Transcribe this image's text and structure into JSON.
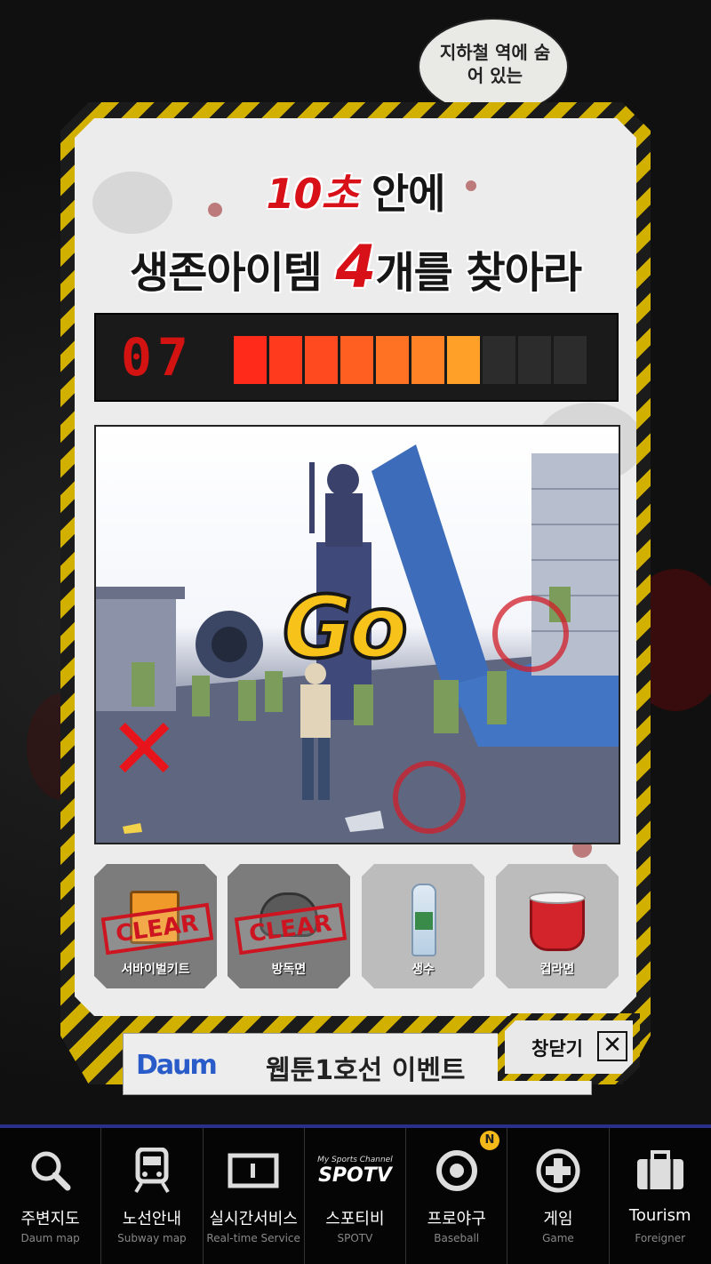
{
  "background": {
    "speech_bubble": "지하철 역에 숨어 있는"
  },
  "popup": {
    "title_line1": {
      "highlight": "10초",
      "rest": " 안에"
    },
    "title_line2": {
      "before": "생존아이템 ",
      "number": "4",
      "after": "개를 찾아라"
    },
    "timer": {
      "value": "07",
      "filled_segments": 7,
      "total_segments": 10,
      "segment_colors": [
        "#ff2a1a",
        "#ff3a1d",
        "#ff4a20",
        "#ff6022",
        "#ff7224",
        "#ff8226",
        "#ffa028"
      ]
    },
    "game_scene": {
      "go_text": "Go"
    },
    "items": [
      {
        "label": "서바이벌키트",
        "status": "CLEAR",
        "found": true
      },
      {
        "label": "방독면",
        "status": "CLEAR",
        "found": true
      },
      {
        "label": "생수",
        "status": "",
        "found": false
      },
      {
        "label": "컵라면",
        "status": "",
        "found": false
      }
    ],
    "close_label": "창닫기",
    "close_icon": "close-icon"
  },
  "banner": {
    "logo": "Daum",
    "text": "웹툰1호선 이벤트"
  },
  "nav": {
    "accent_color": "#2b2f8c",
    "items": [
      {
        "label": "주변지도",
        "sub": "Daum map",
        "icon": "search-icon"
      },
      {
        "label": "노선안내",
        "sub": "Subway map",
        "icon": "train-icon"
      },
      {
        "label": "실시간서비스",
        "sub": "Real-time Service",
        "icon": "display-icon"
      },
      {
        "label": "스포티비",
        "sub": "SPOTV",
        "icon": "spotv-logo-icon",
        "logo_small": "My Sports Channel",
        "logo_text": "SPOTV"
      },
      {
        "label": "프로야구",
        "sub": "Baseball",
        "icon": "baseball-icon",
        "badge": "N"
      },
      {
        "label": "게임",
        "sub": "Game",
        "icon": "gamepad-icon"
      },
      {
        "label": "Tourism",
        "sub": "Foreigner",
        "icon": "suitcase-icon"
      }
    ]
  }
}
